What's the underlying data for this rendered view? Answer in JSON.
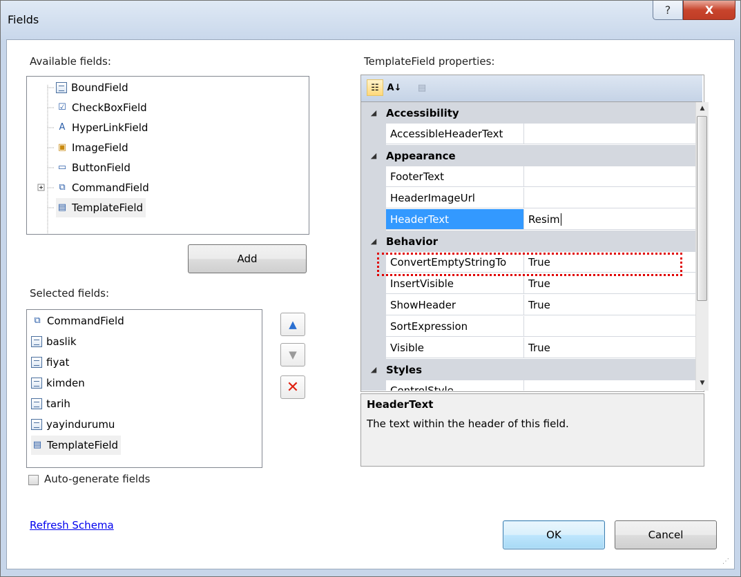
{
  "window": {
    "title": "Fields",
    "help_label": "?",
    "close_label": "X"
  },
  "available": {
    "label": "Available fields:",
    "items": [
      {
        "label": "BoundField",
        "icon": "bound-field-icon"
      },
      {
        "label": "CheckBoxField",
        "icon": "checkbox-field-icon"
      },
      {
        "label": "HyperLinkField",
        "icon": "hyperlink-field-icon"
      },
      {
        "label": "ImageField",
        "icon": "image-field-icon"
      },
      {
        "label": "ButtonField",
        "icon": "button-field-icon"
      },
      {
        "label": "CommandField",
        "icon": "command-field-icon"
      },
      {
        "label": "TemplateField",
        "icon": "template-field-icon"
      }
    ],
    "add_label": "Add"
  },
  "selected": {
    "label": "Selected fields:",
    "items": [
      {
        "label": "CommandField"
      },
      {
        "label": "baslik"
      },
      {
        "label": "fiyat"
      },
      {
        "label": "kimden"
      },
      {
        "label": "tarih"
      },
      {
        "label": "yayindurumu"
      },
      {
        "label": "TemplateField"
      }
    ],
    "autogen_label": "Auto-generate fields",
    "autogen_checked": false
  },
  "refresh_label": "Refresh Schema",
  "properties": {
    "label": "TemplateField properties:",
    "categories": {
      "accessibility": "Accessibility",
      "appearance": "Appearance",
      "behavior": "Behavior",
      "styles": "Styles"
    },
    "rows": {
      "accessible_header_text": {
        "name": "AccessibleHeaderText",
        "value": ""
      },
      "footer_text": {
        "name": "FooterText",
        "value": ""
      },
      "header_image_url": {
        "name": "HeaderImageUrl",
        "value": ""
      },
      "header_text": {
        "name": "HeaderText",
        "value": "Resim"
      },
      "convert_empty": {
        "name": "ConvertEmptyStringTo",
        "value": "True"
      },
      "insert_visible": {
        "name": "InsertVisible",
        "value": "True"
      },
      "show_header": {
        "name": "ShowHeader",
        "value": "True"
      },
      "sort_expression": {
        "name": "SortExpression",
        "value": ""
      },
      "visible": {
        "name": "Visible",
        "value": "True"
      },
      "control_style": {
        "name": "ControlStyle",
        "value": ""
      }
    },
    "description_title": "HeaderText",
    "description_text": "The text within the header of this field."
  },
  "footer": {
    "ok_label": "OK",
    "cancel_label": "Cancel"
  },
  "colors": {
    "selection": "#3399ff",
    "highlight": "#e00000"
  }
}
